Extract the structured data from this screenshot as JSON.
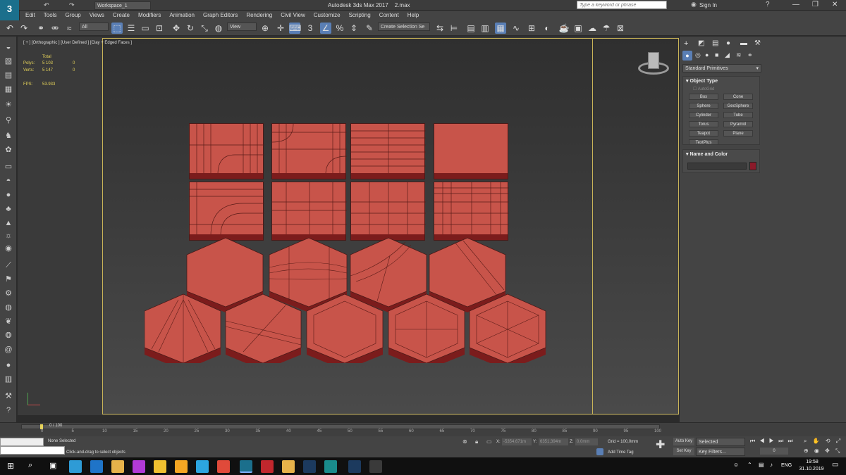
{
  "titlebar": {
    "app_title": "Autodesk 3ds Max 2017",
    "file_name": "2.max",
    "workspace": "Workspace_1",
    "search_placeholder": "Type a keyword or phrase",
    "sign_in": "Sign In"
  },
  "menus": [
    "Edit",
    "Tools",
    "Group",
    "Views",
    "Create",
    "Modifiers",
    "Animation",
    "Graph Editors",
    "Rendering",
    "Civil View",
    "Customize",
    "Scripting",
    "Content",
    "Help"
  ],
  "toolbar": {
    "filter_select": "All",
    "view_select": "View",
    "selection_set": "Create Selection Se"
  },
  "viewport": {
    "label": "[ + ] [Orthographic ] [User Defined ] [Clay + Edged Faces ]",
    "stats": {
      "header": "Total",
      "polys_label": "Polys:",
      "polys_total": "5 103",
      "polys_sel": "0",
      "verts_label": "Verts:",
      "verts_total": "5 147",
      "verts_sel": "0",
      "fps_label": "FPS:",
      "fps_value": "53.933"
    }
  },
  "command_panel": {
    "category": "Standard Primitives",
    "object_type_title": "Object Type",
    "autogrid": "AutoGrid",
    "primitives": [
      "Box",
      "Cone",
      "Sphere",
      "GeoSphere",
      "Cylinder",
      "Tube",
      "Torus",
      "Pyramid",
      "Teapot",
      "Plane",
      "TextPlus"
    ],
    "name_color_title": "Name and Color",
    "object_color": "#8b1a2a"
  },
  "timeline": {
    "frame": "0 / 100",
    "ticks": [
      "0",
      "5",
      "10",
      "15",
      "20",
      "25",
      "30",
      "35",
      "40",
      "45",
      "50",
      "55",
      "60",
      "65",
      "70",
      "75",
      "80",
      "85",
      "90",
      "95",
      "100"
    ]
  },
  "status": {
    "selection": "None Selected",
    "prompt": "Click-and-drag to select objects",
    "x_label": "X:",
    "x_value": "-5354,671m",
    "y_label": "Y:",
    "y_value": "6351,394m",
    "z_label": "Z:",
    "z_value": "0,0mm",
    "grid": "Grid = 100,0mm",
    "add_time_tag": "Add Time Tag",
    "auto_key": "Auto Key",
    "set_key": "Set Key",
    "key_mode": "Selected",
    "key_filters": "Key Filters...",
    "current_frame": "0"
  },
  "taskbar": {
    "lang": "ENG",
    "time": "19:58",
    "date": "31.10.2019"
  },
  "colors": {
    "tile_face": "#c8544a",
    "tile_edge": "#7b1c1c",
    "accent": "#5a7fb5"
  }
}
